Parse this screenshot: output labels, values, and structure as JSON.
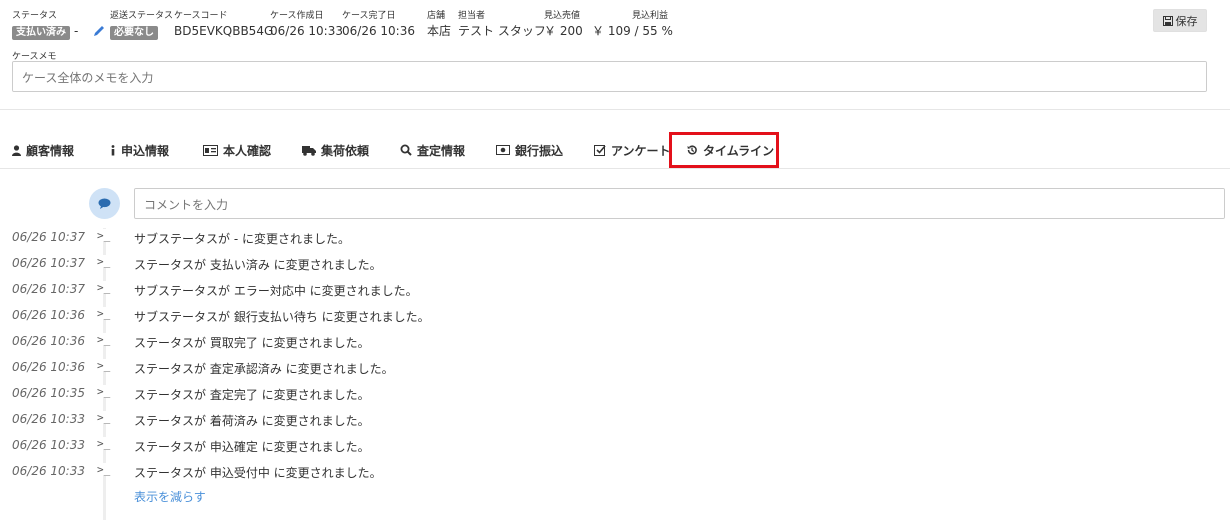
{
  "header": {
    "status": {
      "label": "ステータス",
      "value": "支払い済み"
    },
    "sub_status_dash": "-",
    "return_status": {
      "label": "返送ステータス",
      "value": "必要なし"
    },
    "case_code": {
      "label": "ケースコード",
      "value": "BD5EVKQBB54G"
    },
    "created": {
      "label": "ケース作成日",
      "value": "06/26 10:33"
    },
    "completed": {
      "label": "ケース完了日",
      "value": "06/26 10:36"
    },
    "store": {
      "label": "店舗",
      "value": "本店"
    },
    "staff": {
      "label": "担当者",
      "value": "テスト スタッフ"
    },
    "expected_sales": {
      "label": "見込売値",
      "value": "￥ 200"
    },
    "expected_profit": {
      "label": "見込利益",
      "value": "￥ 109 / 55 %"
    },
    "save_label": "保存"
  },
  "memo": {
    "label": "ケースメモ",
    "placeholder": "ケース全体のメモを入力"
  },
  "tabs": [
    {
      "label": "顧客情報",
      "icon": "user-icon"
    },
    {
      "label": "申込情報",
      "icon": "info-icon"
    },
    {
      "label": "本人確認",
      "icon": "id-card-icon"
    },
    {
      "label": "集荷依頼",
      "icon": "truck-icon"
    },
    {
      "label": "査定情報",
      "icon": "search-icon"
    },
    {
      "label": "銀行振込",
      "icon": "money-icon"
    },
    {
      "label": "アンケート",
      "icon": "check-square-icon"
    },
    {
      "label": "タイムライン",
      "icon": "history-icon",
      "active": true
    }
  ],
  "timeline": {
    "comment_placeholder": "コメントを入力",
    "entries": [
      {
        "time": "06/26 10:37",
        "message": "サブステータスが - に変更されました。"
      },
      {
        "time": "06/26 10:37",
        "message": "ステータスが 支払い済み に変更されました。"
      },
      {
        "time": "06/26 10:37",
        "message": "サブステータスが エラー対応中 に変更されました。"
      },
      {
        "time": "06/26 10:36",
        "message": "サブステータスが 銀行支払い待ち に変更されました。"
      },
      {
        "time": "06/26 10:36",
        "message": "ステータスが 買取完了 に変更されました。"
      },
      {
        "time": "06/26 10:36",
        "message": "ステータスが 査定承認済み に変更されました。"
      },
      {
        "time": "06/26 10:35",
        "message": "ステータスが 査定完了 に変更されました。"
      },
      {
        "time": "06/26 10:33",
        "message": "ステータスが 着荷済み に変更されました。"
      },
      {
        "time": "06/26 10:33",
        "message": "ステータスが 申込確定 に変更されました。"
      },
      {
        "time": "06/26 10:33",
        "message": "ステータスが 申込受付中 に変更されました。"
      }
    ],
    "terminal_glyph": ">_",
    "show_less": "表示を減らす"
  },
  "colors": {
    "active_tab_border": "#e3101a",
    "badge_bg": "#8a8a8a",
    "link": "#4a90d9",
    "comment_bubble_bg": "#cfe2f6"
  }
}
